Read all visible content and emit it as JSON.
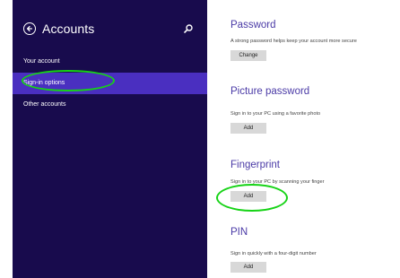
{
  "sidebar": {
    "title": "Accounts",
    "items": [
      {
        "label": "Your account"
      },
      {
        "label": "Sign-in options"
      },
      {
        "label": "Other accounts"
      }
    ]
  },
  "sections": [
    {
      "title": "Password",
      "description": "A strong password helps keep your account more secure",
      "button": "Change"
    },
    {
      "title": "Picture password",
      "description": "Sign in to your PC using a favorite photo",
      "button": "Add"
    },
    {
      "title": "Fingerprint",
      "description": "Sign in to your PC by scanning your finger",
      "button": "Add"
    },
    {
      "title": "PIN",
      "description": "Sign in quickly with a four-digit number",
      "button": "Add"
    }
  ],
  "colors": {
    "sidebar_bg": "#180b4d",
    "selected_bg": "#4a2fc0",
    "heading": "#4a3aa6",
    "highlight_ring": "#16d316"
  },
  "icons": {
    "back": "back-arrow-icon",
    "search": "search-icon"
  }
}
